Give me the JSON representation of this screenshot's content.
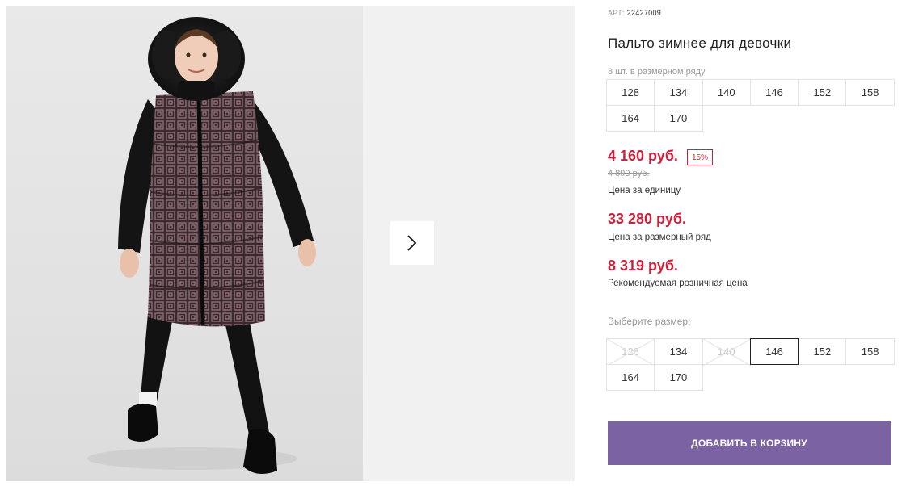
{
  "product": {
    "art_label": "АРТ:",
    "art_number": "22427009",
    "title": "Пальто зимнее для девочки"
  },
  "size_row": {
    "label": "8 шт. в размерном ряду",
    "sizes": [
      "128",
      "134",
      "140",
      "146",
      "152",
      "158",
      "164",
      "170"
    ]
  },
  "prices": {
    "unit_price": "4 160 руб.",
    "discount": "15%",
    "old_price": "4 890 руб.",
    "unit_label": "Цена за единицу",
    "row_price": "33 280 руб.",
    "row_label": "Цена за размерный ряд",
    "retail_price": "8 319 руб.",
    "retail_label": "Рекомендуемая розничная цена"
  },
  "size_picker": {
    "label": "Выберите размер:",
    "sizes": [
      {
        "size": "128",
        "state": "disabled"
      },
      {
        "size": "134",
        "state": "available"
      },
      {
        "size": "140",
        "state": "disabled"
      },
      {
        "size": "146",
        "state": "selected"
      },
      {
        "size": "152",
        "state": "available"
      },
      {
        "size": "158",
        "state": "available"
      },
      {
        "size": "164",
        "state": "available"
      },
      {
        "size": "170",
        "state": "available"
      }
    ]
  },
  "cart_button": "ДОБАВИТЬ В КОРЗИНУ",
  "colors": {
    "price": "#d0203b",
    "button": "#7b63a3"
  },
  "icons": {
    "next": "chevron-right-icon"
  }
}
